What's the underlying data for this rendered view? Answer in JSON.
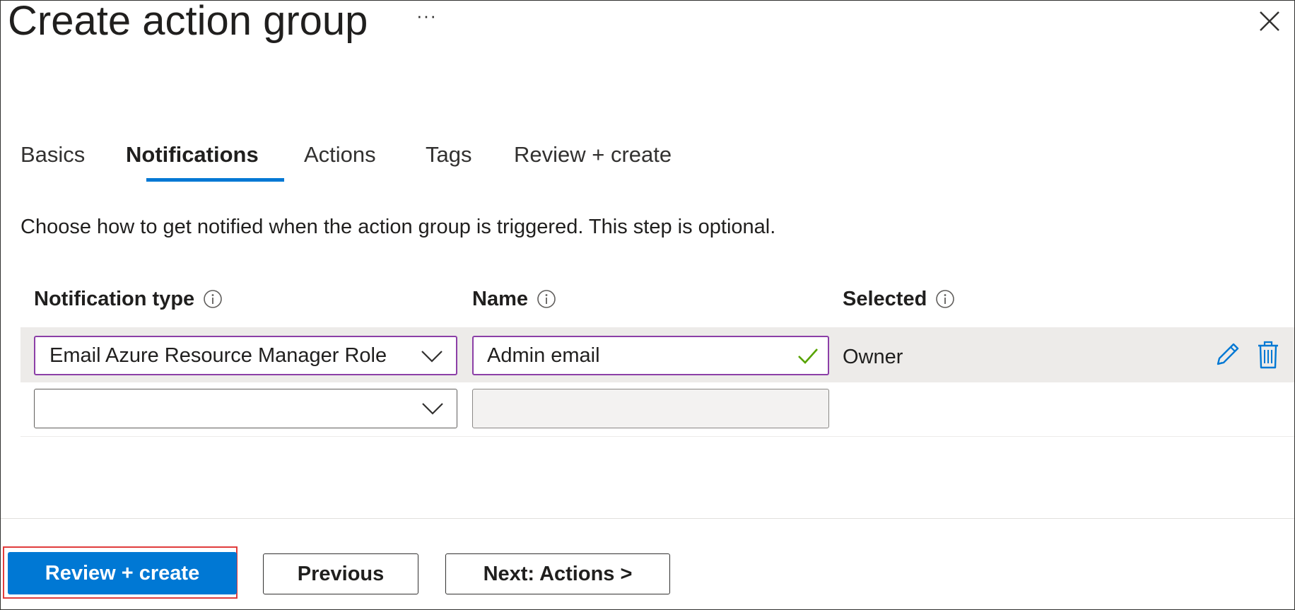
{
  "header": {
    "title": "Create action group",
    "more_label": "···"
  },
  "tabs": [
    {
      "label": "Basics",
      "active": false
    },
    {
      "label": "Notifications",
      "active": true
    },
    {
      "label": "Actions",
      "active": false
    },
    {
      "label": "Tags",
      "active": false
    },
    {
      "label": "Review + create",
      "active": false
    }
  ],
  "description": "Choose how to get notified when the action group is triggered. This step is optional.",
  "table": {
    "columns": [
      "Notification type",
      "Name",
      "Selected"
    ],
    "rows": [
      {
        "notification_type": "Email Azure Resource Manager Role",
        "name": "Admin email",
        "selected": "Owner",
        "valid": true
      },
      {
        "notification_type": "",
        "name": "",
        "selected": ""
      }
    ]
  },
  "footer": {
    "review_create_label": "Review + create",
    "previous_label": "Previous",
    "next_label": "Next: Actions >"
  },
  "colors": {
    "accent": "#0078d4",
    "focus_border": "#8c3fa7",
    "highlight": "#e03c3c",
    "check": "#57a300"
  }
}
